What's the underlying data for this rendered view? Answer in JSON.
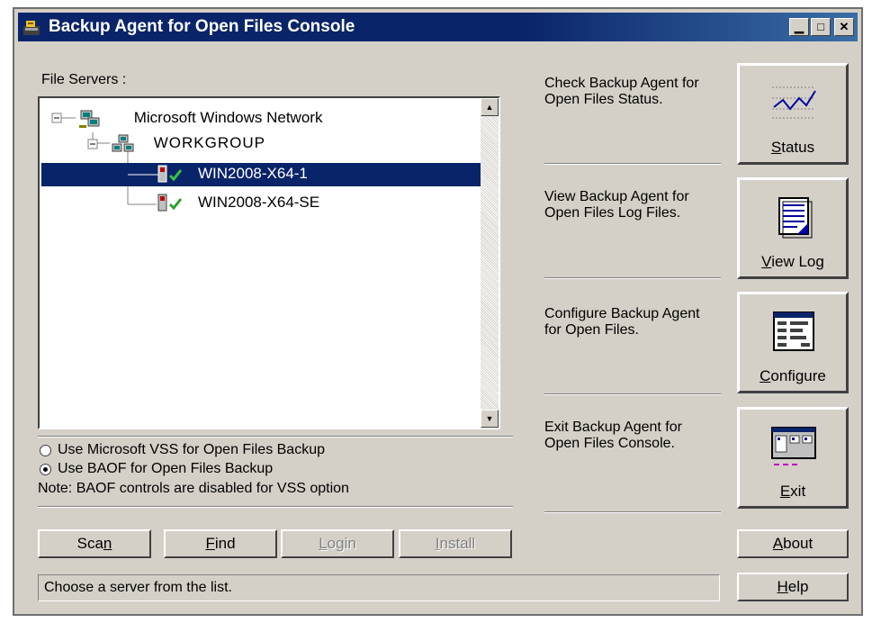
{
  "window": {
    "title": "Backup Agent for Open Files Console",
    "controls": [
      "minimize-icon",
      "maximize-icon",
      "close-icon"
    ]
  },
  "servers": {
    "label": "File Servers :",
    "tree": [
      {
        "level": 0,
        "text": "Microsoft Windows Network",
        "icon": "network-icon",
        "expanded": true
      },
      {
        "level": 1,
        "text": "WORKGROUP",
        "icon": "workgroup-icon",
        "expanded": true
      },
      {
        "level": 2,
        "text": "WIN2008-X64-1",
        "icon": "server-check-icon",
        "selected": true
      },
      {
        "level": 2,
        "text": "WIN2008-X64-SE",
        "icon": "server-check-icon",
        "selected": false
      }
    ]
  },
  "options": {
    "vss_label": "Use Microsoft VSS for Open Files Backup",
    "baof_label": "Use BAOF for Open Files Backup",
    "selected": "baof",
    "note": "Note: BAOF controls are disabled for VSS option"
  },
  "buttons": {
    "scan": {
      "pre": "Sca",
      "u": "n",
      "post": "",
      "enabled": true
    },
    "find": {
      "pre": "",
      "u": "F",
      "post": "ind",
      "enabled": true
    },
    "login": {
      "pre": "",
      "u": "L",
      "post": "ogin",
      "enabled": false
    },
    "install": {
      "pre": "",
      "u": "I",
      "post": "nstall",
      "enabled": false
    },
    "about": {
      "pre": "",
      "u": "A",
      "post": "bout"
    },
    "help": {
      "pre": "",
      "u": "H",
      "post": "elp"
    }
  },
  "actions": [
    {
      "desc": "Check Backup Agent for Open Files Status.",
      "pre": "",
      "u": "S",
      "post": "tatus",
      "icon": "status-chart-icon"
    },
    {
      "desc": "View Backup Agent for Open Files Log Files.",
      "pre": "",
      "u": "V",
      "post": "iew Log",
      "icon": "log-document-icon"
    },
    {
      "desc": "Configure Backup Agent for Open Files.",
      "pre": "",
      "u": "C",
      "post": "onfigure",
      "icon": "configure-window-icon"
    },
    {
      "desc": "Exit Backup Agent for Open Files Console.",
      "pre": "",
      "u": "E",
      "post": "xit",
      "icon": "exit-window-icon"
    }
  ],
  "status_bar": "Choose a server from the list.",
  "colors": {
    "selection": "#0a246a",
    "titlebar": "#0a246a",
    "face": "#d4d0c8",
    "check": "#2e9e2e"
  }
}
